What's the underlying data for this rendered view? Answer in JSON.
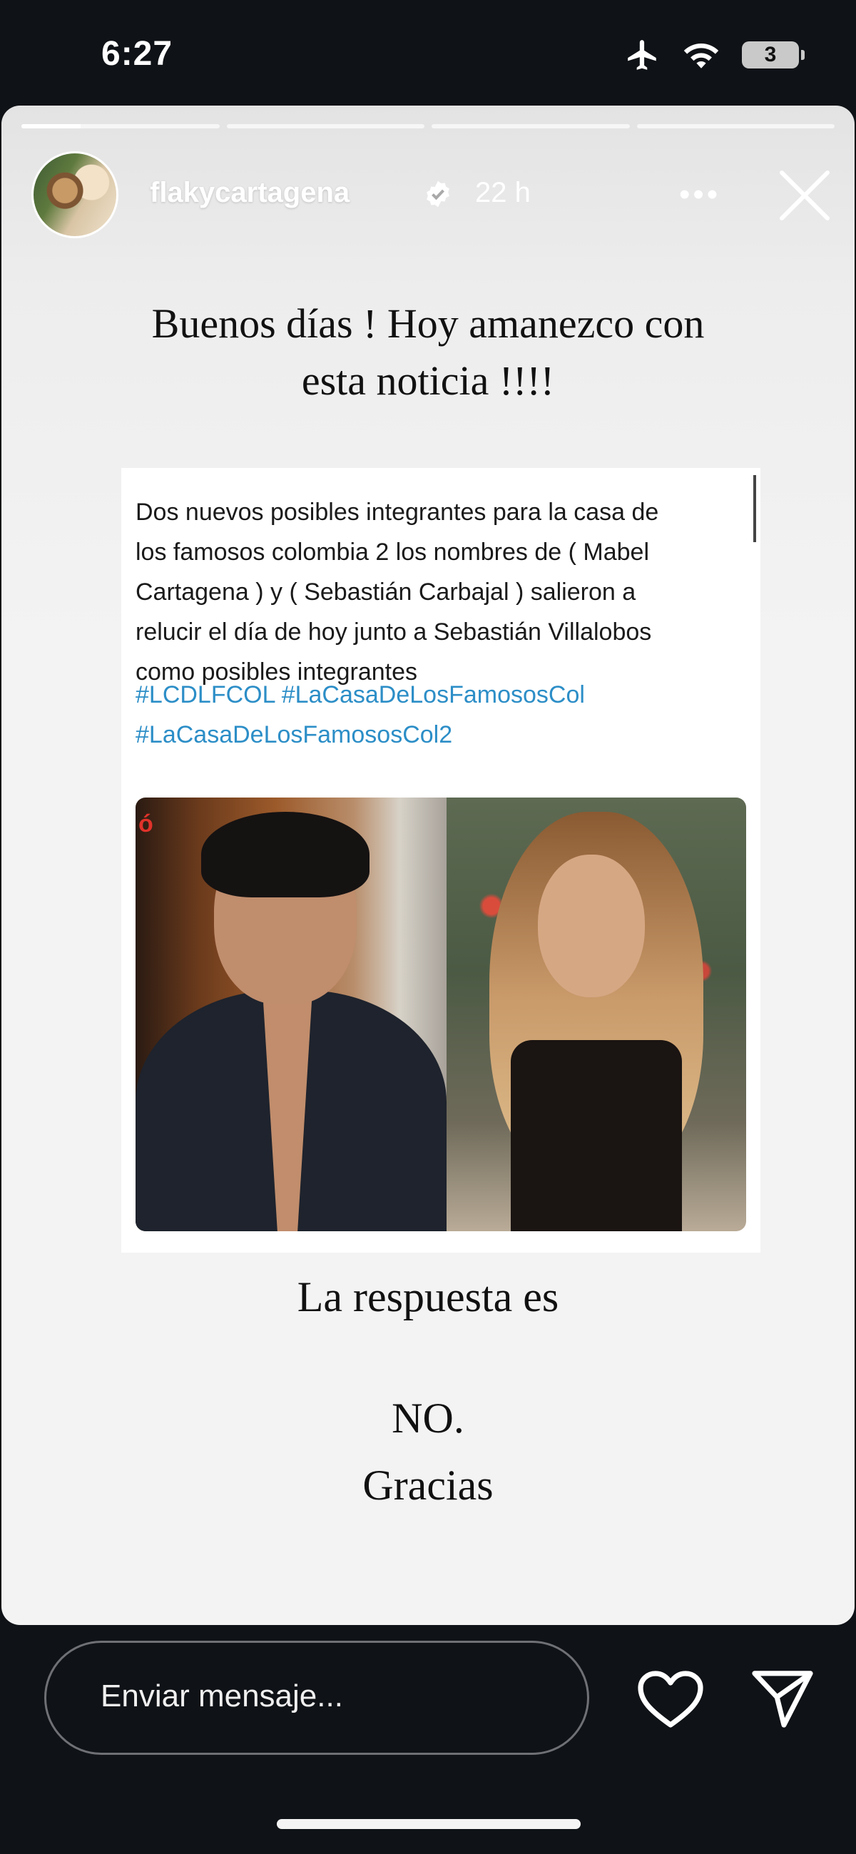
{
  "status_bar": {
    "time": "6:27",
    "battery": "3",
    "icons": [
      "airplane-icon",
      "wifi-icon",
      "battery-icon"
    ]
  },
  "story": {
    "progress": {
      "segments": 4,
      "active_index": 0,
      "active_fraction": 0.3
    },
    "username": "flakycartagena",
    "verified": true,
    "time_ago": "22 h",
    "more_label": "•••",
    "intro_line1": "Buenos días ! Hoy amanezco con",
    "intro_line2": "esta noticia !!!!",
    "tweet": {
      "text_line1": "Dos nuevos posibles integrantes para la casa de",
      "text_line2": "los famosos colombia 2 los nombres de ( Mabel",
      "text_line3": "Cartagena )  y ( Sebastián Carbajal ) salieron a",
      "text_line4": "relucir el día de hoy junto a Sebastián Villalobos",
      "text_line5": "como posibles integrantes",
      "hashtag_line1": "#LCDLFCOL #LaCasaDeLosFamososCol",
      "hashtag_line2": "#LaCasaDeLosFamososCol2",
      "corner_mark": "ó"
    },
    "answer_line": "La respuesta es",
    "no_line": "NO.",
    "thanks_line": "Gracias"
  },
  "footer": {
    "message_placeholder": "Enviar mensaje...",
    "icons": [
      "heart-icon",
      "send-icon"
    ]
  },
  "colors": {
    "background": "#0f1216",
    "story_bg": "#f3f3f3",
    "hashtag": "#2c8ec7",
    "text": "#111111"
  }
}
